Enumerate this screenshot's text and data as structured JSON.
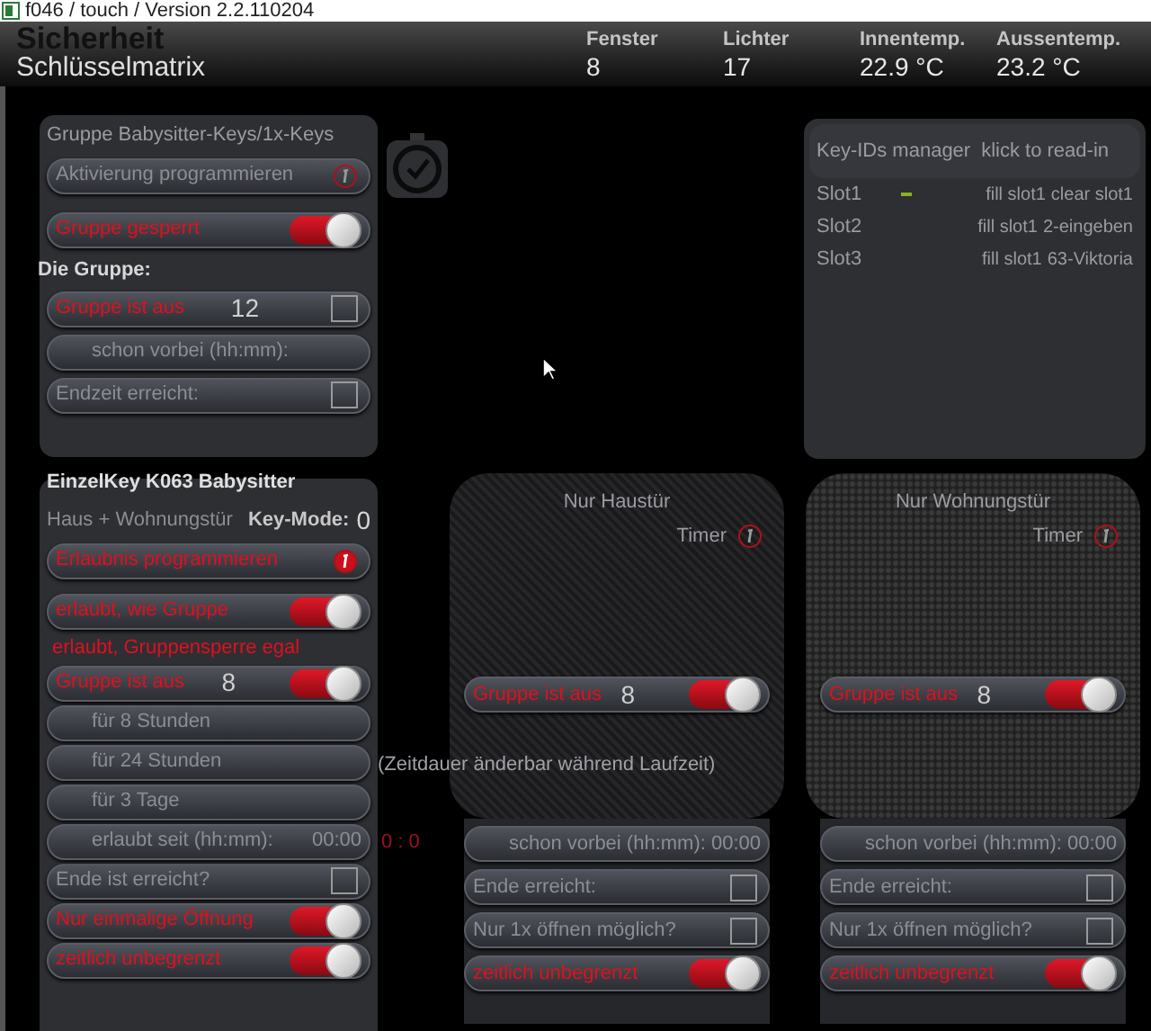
{
  "window": {
    "title": "f046 / touch / Version 2.2.110204"
  },
  "header": {
    "title": "Sicherheit",
    "subtitle": "Schlüsselmatrix",
    "stats": [
      {
        "label": "Fenster",
        "value": "8"
      },
      {
        "label": "Lichter",
        "value": "17"
      },
      {
        "label": "Innentemp.",
        "value": "22.9 °C"
      },
      {
        "label": "Aussentemp.",
        "value": "23.2 °C"
      }
    ]
  },
  "group_panel": {
    "title": "Gruppe Babysitter-Keys/1x-Keys",
    "rows": [
      {
        "kind": "button",
        "label": "Aktivierung programmieren",
        "active": false
      },
      {
        "kind": "toggle",
        "label": "Gruppe gesperrt",
        "active": true,
        "on": true
      },
      {
        "kind": "heading",
        "label": "Die Gruppe:",
        "active": false
      },
      {
        "kind": "checkbox",
        "label": "Gruppe ist aus",
        "active": true,
        "value": "12",
        "checked": false
      },
      {
        "kind": "time",
        "label": "schon vorbei (hh:mm):"
      },
      {
        "kind": "checkbox",
        "label": "Endzeit erreicht:",
        "active": false,
        "checked": false
      }
    ]
  },
  "key_ids": {
    "title": "Key-IDs manager",
    "action": "klick to read-in",
    "slots": [
      {
        "name": "Slot1",
        "marker": true,
        "fill": "fill slot1",
        "value": "clear slot1"
      },
      {
        "name": "Slot2",
        "marker": false,
        "fill": "fill slot1",
        "value": "2-eingeben"
      },
      {
        "name": "Slot3",
        "marker": false,
        "fill": "fill slot1",
        "value": "63-Viktoria"
      }
    ]
  },
  "key_panel": {
    "title": "EinzelKey K063 Babysitter",
    "subtitle": "Haus + Wohnungstür",
    "mode_label": "Key-Mode:",
    "mode_value": "0",
    "rows": [
      {
        "kind": "button",
        "label": "Erlaubnis programmieren",
        "active": true
      },
      {
        "kind": "toggle",
        "label": "erlaubt, wie Gruppe",
        "active": true,
        "on": true
      },
      {
        "kind": "heading",
        "label": "erlaubt, Gruppensperre egal",
        "active": true
      },
      {
        "kind": "toggle",
        "label": "Gruppe ist aus",
        "active": true,
        "on": true,
        "value": "8"
      },
      {
        "kind": "plain",
        "label": "für 8 Stunden"
      },
      {
        "kind": "plain",
        "label": "für 24 Stunden",
        "note": "(Zeitdauer änderbar während Laufzeit)"
      },
      {
        "kind": "plain",
        "label": "für 3 Tage"
      },
      {
        "kind": "time",
        "label": "erlaubt seit (hh:mm):",
        "value": "00:00",
        "side": "0 : 0"
      },
      {
        "kind": "checkbox",
        "label": "Ende ist erreicht?",
        "active": false,
        "checked": false
      },
      {
        "kind": "toggle",
        "label": "Nur einmalige Öffnung",
        "active": true,
        "on": true
      },
      {
        "kind": "toggle",
        "label": "zeitlich unbegrenzt",
        "active": true,
        "on": true
      }
    ]
  },
  "doors": [
    {
      "title": "Nur Haustür",
      "timer": "Timer",
      "top_row": {
        "kind": "toggle",
        "label": "Gruppe ist aus",
        "active": true,
        "on": true,
        "value": "8"
      },
      "rows": [
        {
          "kind": "time",
          "label": "schon vorbei (hh:mm):",
          "value": "00:00"
        },
        {
          "kind": "checkbox",
          "label": "Ende erreicht:",
          "active": false,
          "checked": false
        },
        {
          "kind": "checkbox",
          "label": "Nur 1x öffnen möglich?",
          "active": false,
          "checked": false
        },
        {
          "kind": "toggle",
          "label": "zeitlich unbegrenzt",
          "active": true,
          "on": true
        }
      ]
    },
    {
      "title": "Nur Wohnungstür",
      "timer": "Timer",
      "top_row": {
        "kind": "toggle",
        "label": "Gruppe ist aus",
        "active": true,
        "on": true,
        "value": "8"
      },
      "rows": [
        {
          "kind": "time",
          "label": "schon vorbei (hh:mm):",
          "value": "00:00"
        },
        {
          "kind": "checkbox",
          "label": "Ende erreicht:",
          "active": false,
          "checked": false
        },
        {
          "kind": "checkbox",
          "label": "Nur 1x öffnen möglich?",
          "active": false,
          "checked": false
        },
        {
          "kind": "toggle",
          "label": "zeitlich unbegrenzt",
          "active": true,
          "on": true
        }
      ]
    }
  ]
}
